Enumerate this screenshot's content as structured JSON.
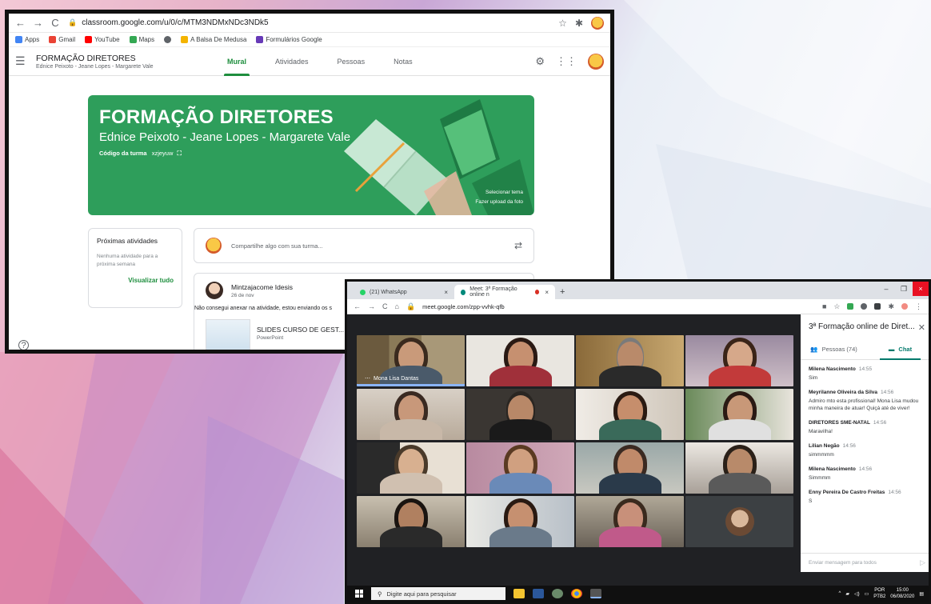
{
  "classroom": {
    "url": "classroom.google.com/u/0/c/MTM3NDMxNDc3NDk5",
    "bookmarks": [
      {
        "label": "Apps",
        "color": "#4285f4"
      },
      {
        "label": "Gmail",
        "color": "#ea4335"
      },
      {
        "label": "YouTube",
        "color": "#ff0000"
      },
      {
        "label": "Maps",
        "color": "#34a853"
      },
      {
        "label": "",
        "color": "#5f6368"
      },
      {
        "label": "A Balsa De Medusa",
        "color": "#f4b400"
      },
      {
        "label": "Formulários Google",
        "color": "#673ab7"
      }
    ],
    "class_title": "FORMAÇÃO DIRETORES",
    "class_subtitle": "Ednice Peixoto - Jeane Lopes - Margarete Vale",
    "tabs": [
      "Mural",
      "Atividades",
      "Pessoas",
      "Notas"
    ],
    "banner": {
      "title": "FORMAÇÃO DIRETORES",
      "subtitle": "Ednice Peixoto - Jeane Lopes - Margarete Vale",
      "code_label": "Código da turma",
      "code": "xzjeyuw",
      "select_theme": "Selecionar tema",
      "upload_photo": "Fazer upload da foto",
      "color": "#2e9e5b"
    },
    "upcoming": {
      "title": "Próximas atividades",
      "empty": "Nenhuma atividade para a próxima semana",
      "link": "Visualizar tudo"
    },
    "share_placeholder": "Compartilhe algo com sua turma...",
    "post": {
      "author": "Mintzajacome Idesis",
      "date": "26 de nov",
      "text": "Não consegui anexar na atividade, estou enviando os s",
      "attachment_title": "SLIDES CURSO DE GEST...",
      "attachment_type": "PowerPoint"
    },
    "help": "?"
  },
  "meet": {
    "tabs": [
      {
        "label": "(21) WhatsApp",
        "color": "#25d366"
      },
      {
        "label": "Meet: 3ª Formação online n",
        "color": "#00897b"
      }
    ],
    "url": "meet.google.com/zpp-vvhk-qfb",
    "speaker_name": "Mona Lisa Dantas",
    "panel_title": "3ª Formação online de Diret...",
    "people_tab": "Pessoas (74)",
    "chat_tab": "Chat",
    "messages": [
      {
        "who": "Milena Nascimento",
        "time": "14:55",
        "text": "Sim"
      },
      {
        "who": "Meyrilanne Oliveira da Silva",
        "time": "14:56",
        "text": "Admiro mto esta profissional! Mona Lisa mudou minha maneira de atuar! Quiçá até de viver!"
      },
      {
        "who": "DIRETORES SME-NATAL",
        "time": "14:56",
        "text": "Maravilha!"
      },
      {
        "who": "Lilian Negão",
        "time": "14:56",
        "text": "simmmmm"
      },
      {
        "who": "Milena Nascimento",
        "time": "14:56",
        "text": "Simmmm"
      },
      {
        "who": "Enny Pereira De Castro Freitas",
        "time": "14:56",
        "text": "S"
      }
    ],
    "send_placeholder": "Enviar mensagem para todos",
    "taskbar_search": "Digite aqui para pesquisar",
    "lang": "POR",
    "lang2": "PTB2",
    "time": "15:00",
    "date": "06/08/2020"
  }
}
